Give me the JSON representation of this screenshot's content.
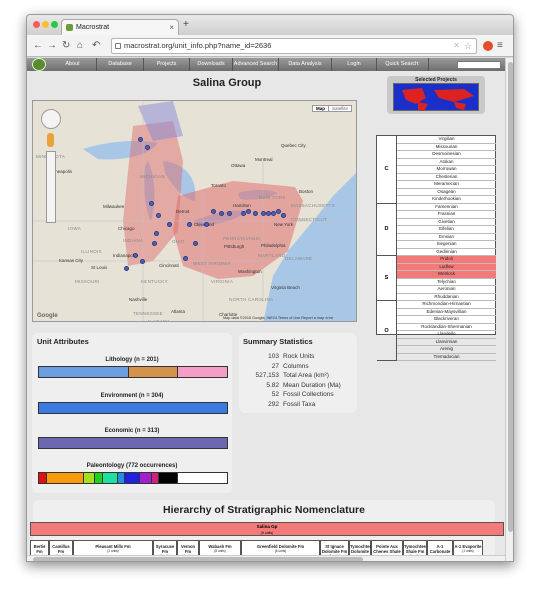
{
  "browser": {
    "tab_title": "Macrostrat",
    "tab_close": "×",
    "new_tab": "+",
    "url": "macrostrat.org/unit_info.php?name_id=2636",
    "back": "←",
    "forward": "→",
    "reload": "↻",
    "home": "⌂",
    "history": "↶",
    "menu": "≡"
  },
  "nav": {
    "items": [
      "About",
      "Database",
      "Projects",
      "Downloads",
      "Advanced Search",
      "Data Analysis",
      "Login",
      "Quick Search:"
    ]
  },
  "page_title": "Salina Group",
  "map": {
    "type_map": "Map",
    "type_sat": "Satellite",
    "footer": "Map data ©2015 Google, INEGI   Terms of Use   Report a map error",
    "google": "Google",
    "labels": [
      "Quebec City",
      "Ottawa",
      "Montreal",
      "MINNESOTA",
      "Minneapolis",
      "Toronto",
      "Milwaukee",
      "MICHIGAN",
      "NEW YORK",
      "Boston",
      "MASSACHUSETTS",
      "Chicago",
      "Detroit",
      "Hamilton",
      "CONNECTICUT",
      "IOWA",
      "Cleveland",
      "New York",
      "ILLINOIS",
      "INDIANA",
      "OHIO",
      "PENNSYLVANIA",
      "Philadelphia",
      "Indianapolis",
      "Pittsburgh",
      "MARYLAND",
      "DELAWARE",
      "Kansas City",
      "St Louis",
      "Cincinnati",
      "Washington",
      "MISSOURI",
      "KENTUCKY",
      "WEST VIRGINIA",
      "VIRGINIA",
      "Nashville",
      "Virginia Beach",
      "NORTH CAROLINA",
      "TENNESSEE",
      "Atlanta",
      "Charlotte",
      "ALABAMA",
      "SOUTH CAROLINA"
    ]
  },
  "selected_projects": "Selected Projects",
  "timescale": {
    "periods": [
      {
        "code": "C",
        "stages": [
          "Virgilian",
          "Missourian",
          "Desmoinesian",
          "Atokan",
          "Morrowan",
          "Chesterian",
          "Meramecian",
          "Osagean",
          "Kinderhookian"
        ]
      },
      {
        "code": "D",
        "stages": [
          "Famennian",
          "Frasnian",
          "Givetian",
          "Eifelian",
          "Emsian",
          "Siegenian",
          "Gedinnian"
        ]
      },
      {
        "code": "S",
        "stages": [
          "Pridoli",
          "Ludlow",
          "Wenlock",
          "Telychian",
          "Aeronian",
          "Rhuddanian"
        ]
      },
      {
        "code": "O",
        "stages": [
          "Richmondian-Hirnantian",
          "Edenian-Maysvillian",
          "Blackriveran",
          "Rocklandian-Shermanian",
          "Llandeilo",
          "Llanvirnian",
          "Arenig",
          "Tremadocian"
        ]
      }
    ],
    "selected": [
      "Pridoli",
      "Ludlow",
      "Wenlock"
    ]
  },
  "unit_attributes": {
    "title": "Unit Attributes",
    "lithology": {
      "title": "Lithology (n = 201)",
      "segments": [
        {
          "frac": 0.48,
          "color": "#6a9ee0"
        },
        {
          "frac": 0.26,
          "color": "#d4934a"
        },
        {
          "frac": 0.26,
          "color": "#f29ec6"
        }
      ]
    },
    "environment": {
      "title": "Environment (n = 304)",
      "segments": [
        {
          "frac": 1.0,
          "color": "#3a7ae0"
        }
      ]
    },
    "economic": {
      "title": "Economic (n = 313)",
      "segments": [
        {
          "frac": 1.0,
          "color": "#6b68b0"
        }
      ]
    },
    "paleontology": {
      "title": "Paleontology (772 occurrences)",
      "segments": [
        {
          "frac": 0.04,
          "color": "#e01010"
        },
        {
          "frac": 0.2,
          "color": "#f79a10"
        },
        {
          "frac": 0.06,
          "color": "#a4e020"
        },
        {
          "frac": 0.04,
          "color": "#20d020"
        },
        {
          "frac": 0.08,
          "color": "#20e0a0"
        },
        {
          "frac": 0.04,
          "color": "#2090e0"
        },
        {
          "frac": 0.08,
          "color": "#2020e0"
        },
        {
          "frac": 0.06,
          "color": "#a020d0"
        },
        {
          "frac": 0.04,
          "color": "#d02080"
        },
        {
          "frac": 0.1,
          "color": "#000000"
        },
        {
          "frac": 0.26,
          "color": "#ffffff"
        }
      ]
    }
  },
  "summary": {
    "title": "Summary Statistics",
    "rows": [
      {
        "value": "103",
        "label": "Rock Units"
      },
      {
        "value": "27",
        "label": "Columns"
      },
      {
        "value": "527,153",
        "label": "Total Area (km²)"
      },
      {
        "value": "5.82",
        "label": "Mean Duration (Ma)"
      },
      {
        "value": "52",
        "label": "Fossil Collections"
      },
      {
        "value": "292",
        "label": "Fossil Taxa"
      }
    ]
  },
  "hierarchy": {
    "title": "Hierarchy of Stratigraphic Nomenclature",
    "group": "Salina Gp",
    "group_sub": "(9 units)",
    "units": [
      {
        "name": "Bertie Fm",
        "sub": "(1 units)"
      },
      {
        "name": "Camillus Fm",
        "sub": "(4 units)"
      },
      {
        "name": "Pleasant Mills Fm",
        "sub": "(1 units)"
      },
      {
        "name": "Syracuse Fm",
        "sub": "(4 units)"
      },
      {
        "name": "Vernon Fm",
        "sub": "(4 units)"
      },
      {
        "name": "Wabash Fm",
        "sub": "(8 units)"
      },
      {
        "name": "Greenfield Dolomite Fm",
        "sub": "(6 units)"
      },
      {
        "name": "St Ignace Dolomite Fm",
        "sub": "(1 units)"
      },
      {
        "name": "Tymochtee Dolomite Fm",
        "sub": "(1 units)"
      },
      {
        "name": "Pointe Aux Chenes Shale Fm",
        "sub": "(1 units)"
      },
      {
        "name": "Tymochtee Shale Fm",
        "sub": "(1 units)"
      },
      {
        "name": "A-1 Carbonate Fm",
        "sub": "(1 units)"
      },
      {
        "name": "A-1 Evaporite",
        "sub": "(1 units)"
      }
    ]
  }
}
